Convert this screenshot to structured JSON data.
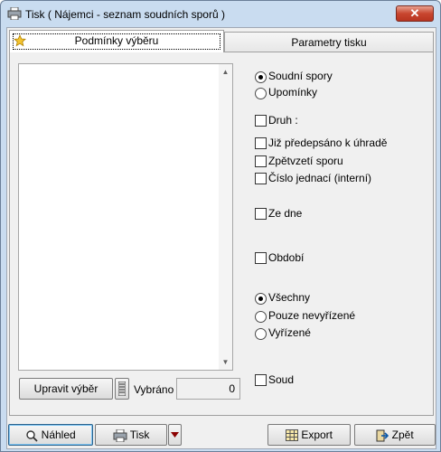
{
  "window": {
    "title": "Tisk ( Nájemci - seznam soudních sporů )",
    "close_symbol": "✕"
  },
  "tabs": [
    {
      "label": "Podmínky výběru",
      "active": true
    },
    {
      "label": "Parametry tisku",
      "active": false
    }
  ],
  "left": {
    "edit_button": "Upravit výběr",
    "selected_label": "Vybráno",
    "selected_value": "0"
  },
  "options": {
    "type_radios": [
      {
        "label": "Soudní spory",
        "checked": true
      },
      {
        "label": "Upomínky",
        "checked": false
      }
    ],
    "checkboxes_top": [
      {
        "label": "Druh :",
        "checked": false
      },
      {
        "label": "Již předepsáno k úhradě",
        "checked": false
      },
      {
        "label": "Zpětvzetí sporu",
        "checked": false
      },
      {
        "label": "Číslo jednací (interní)",
        "checked": false
      }
    ],
    "ze_dne": {
      "label": "Ze dne",
      "checked": false
    },
    "obdobi": {
      "label": "Období",
      "checked": false
    },
    "state_radios": [
      {
        "label": "Všechny",
        "checked": true
      },
      {
        "label": "Pouze nevyřízené",
        "checked": false
      },
      {
        "label": "Vyřízené",
        "checked": false
      }
    ],
    "soud": {
      "label": "Soud",
      "checked": false
    }
  },
  "footer": {
    "preview": "Náhled",
    "print": "Tisk",
    "export": "Export",
    "back": "Zpět"
  },
  "colors": {
    "frame": "#c9dcf0",
    "close": "#c8462f"
  }
}
